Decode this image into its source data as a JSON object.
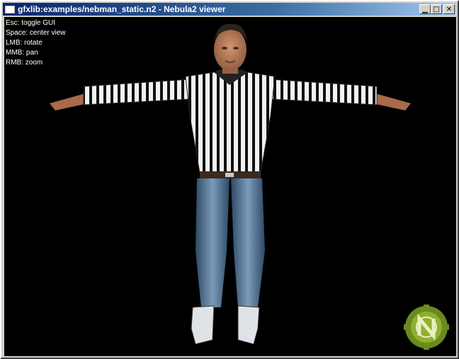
{
  "window": {
    "title": "gfxlib:examples/nebman_static.n2 - Nebula2 viewer",
    "buttons": {
      "minimize": "▁",
      "maximize": "□",
      "close": "✕"
    }
  },
  "help": {
    "lines": [
      "Esc: toggle GUI",
      "Space: center view",
      "LMB: rotate",
      "MMB: pan",
      "RMB: zoom"
    ]
  },
  "scene": {
    "model": "referee character",
    "background": "#000000",
    "logo_icon": "nebula-logo-icon"
  }
}
